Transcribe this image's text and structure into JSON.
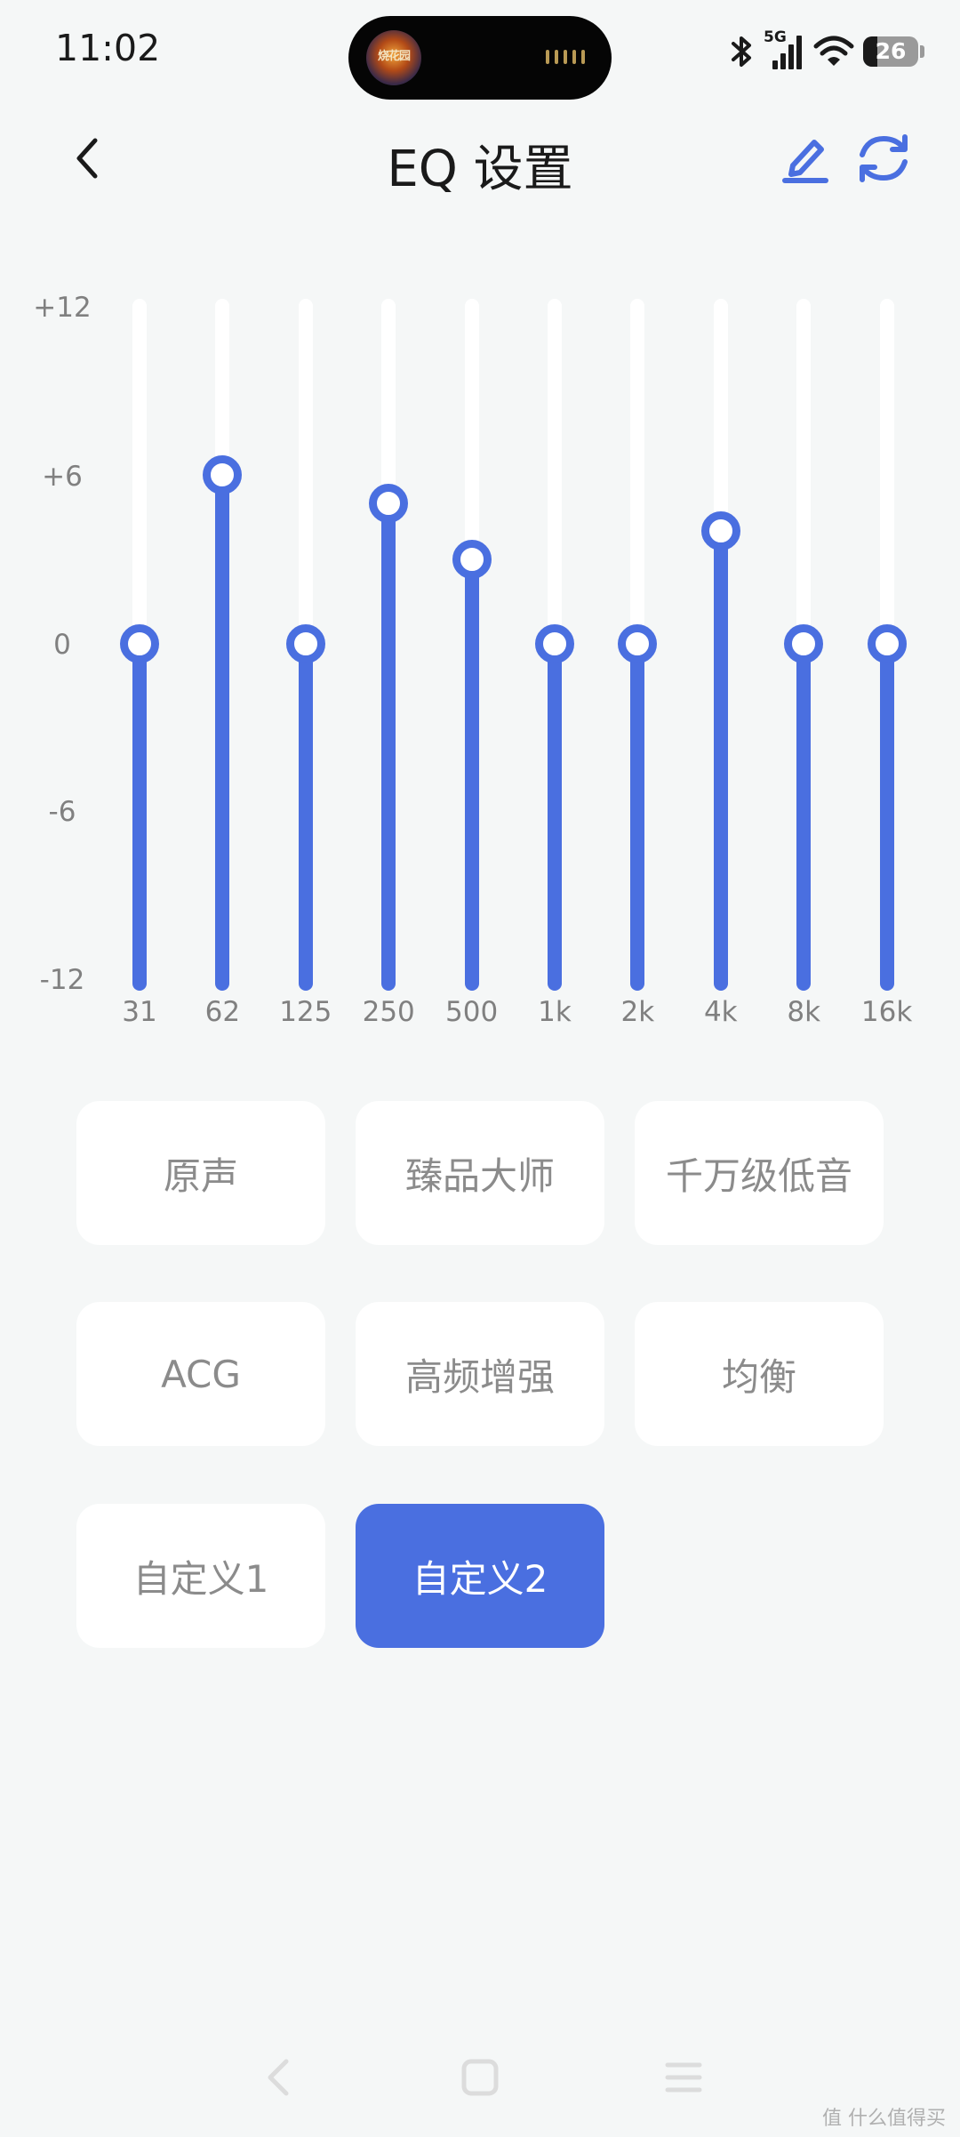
{
  "status_bar": {
    "time": "11:02",
    "network_label": "5G",
    "battery_level": "26",
    "island_art_text": "烧花园"
  },
  "header": {
    "title": "EQ 设置"
  },
  "eq": {
    "y_axis_labels": [
      "+12",
      "+6",
      "0",
      "-6",
      "-12"
    ],
    "bands": [
      {
        "freq": "31",
        "gain": 0
      },
      {
        "freq": "62",
        "gain": 6
      },
      {
        "freq": "125",
        "gain": 0
      },
      {
        "freq": "250",
        "gain": 5
      },
      {
        "freq": "500",
        "gain": 3
      },
      {
        "freq": "1k",
        "gain": 0
      },
      {
        "freq": "2k",
        "gain": 0
      },
      {
        "freq": "4k",
        "gain": 4
      },
      {
        "freq": "8k",
        "gain": 0
      },
      {
        "freq": "16k",
        "gain": 0
      }
    ],
    "gain_range": [
      -12,
      12
    ]
  },
  "presets": [
    {
      "label": "原声"
    },
    {
      "label": "臻品大师"
    },
    {
      "label": "千万级低音"
    },
    {
      "label": "ACG"
    },
    {
      "label": "高频增强"
    },
    {
      "label": "均衡"
    },
    {
      "label": "自定义1"
    },
    {
      "label": "自定义2"
    }
  ],
  "selected_preset": "自定义2",
  "colors": {
    "accent": "#4a6fe0",
    "background": "#f5f7f7",
    "card": "#ffffff",
    "muted_text": "#8b8b8b"
  },
  "watermark": "值 什么值得买"
}
